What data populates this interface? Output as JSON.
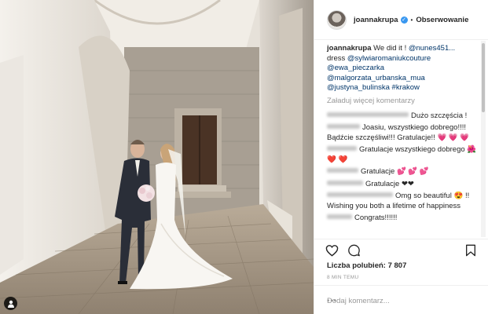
{
  "header": {
    "username": "joannakrupa",
    "separator": "•",
    "follow_label": "Obserwowanie"
  },
  "caption": {
    "username": "joannakrupa",
    "text": "We did it ! ",
    "mention_main": "@nunes451...",
    "dress_label": "dress ",
    "mentions": [
      "@sylwiaromaniukcouture",
      "@ewa_pieczarka",
      "@malgorzata_urbanska_mua",
      "@justyna_bulinska",
      "#krakow"
    ]
  },
  "load_more_label": "Załaduj więcej komentarzy",
  "comments": [
    {
      "text": "Dużo szczęścia !"
    },
    {
      "text": "Joasiu, wszystkiego dobrego!!!! Bądźcie szczęśliwi!!! Gratulacje!! ",
      "emoji": "💗 💗 💗"
    },
    {
      "text": "Gratulacje wszystkiego dobrego ",
      "emoji": "🌺 ❤️ ❤️"
    },
    {
      "text": "Gratulacje ",
      "emoji": "💕 💕 💕"
    },
    {
      "text": "Gratulacje ",
      "emoji": "❤❤"
    },
    {
      "text": "Omg so beautiful ",
      "lead_emoji": "😍",
      "text2": " !! Wishing you both a lifetime of happiness"
    },
    {
      "text": "Congrats!!!!!!"
    }
  ],
  "likes_label": "Liczba polubień: 7 807",
  "time_label": "8 MIN TEMU",
  "add_comment_placeholder": "Dodaj komentarz...",
  "options_label": "•••",
  "icons": {
    "like": "heart-icon",
    "comment": "comment-icon",
    "save": "bookmark-icon",
    "tag": "user-tag-icon"
  },
  "colors": {
    "link": "#003569",
    "verified": "#3897f0",
    "muted": "#999999"
  }
}
